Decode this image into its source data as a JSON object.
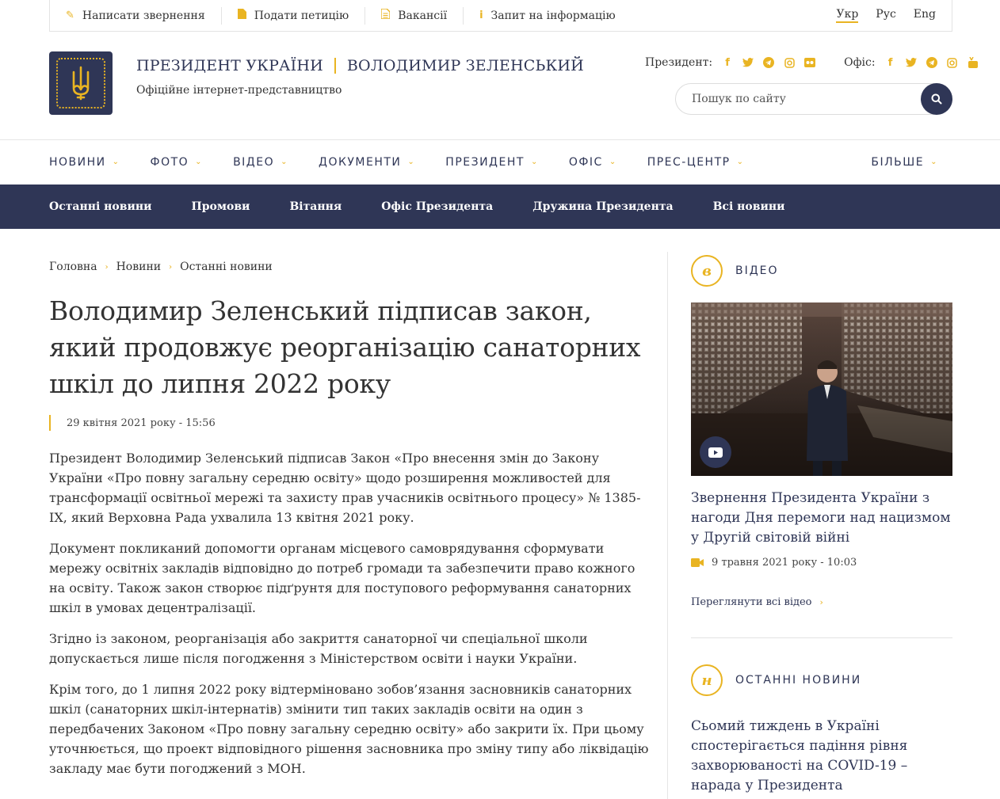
{
  "utility": {
    "links": [
      {
        "label": "Написати звернення",
        "icon": "pencil-icon"
      },
      {
        "label": "Подати петицію",
        "icon": "document-icon"
      },
      {
        "label": "Вакансії",
        "icon": "list-icon"
      },
      {
        "label": "Запит на інформацію",
        "icon": "info-icon"
      }
    ],
    "languages": [
      "Укр",
      "Рус",
      "Eng"
    ],
    "active_language": "Укр"
  },
  "header": {
    "title_left": "ПРЕЗИДЕНТ УКРАЇНИ",
    "title_right": "ВОЛОДИМИР ЗЕЛЕНСЬКИЙ",
    "subtitle": "Офіційне інтернет-представництво",
    "president_label": "Президент:",
    "office_label": "Офіс:",
    "president_socials": [
      "facebook-icon",
      "twitter-icon",
      "telegram-icon",
      "instagram-icon",
      "flickr-icon"
    ],
    "office_socials": [
      "facebook-icon",
      "twitter-icon",
      "telegram-icon",
      "instagram-icon",
      "youtube-icon"
    ],
    "search_placeholder": "Пошук по сайту"
  },
  "main_nav": {
    "items": [
      "НОВИНИ",
      "ФОТО",
      "ВІДЕО",
      "ДОКУМЕНТИ",
      "ПРЕЗИДЕНТ",
      "ОФІС",
      "ПРЕС-ЦЕНТР"
    ],
    "more": "БІЛЬШЕ"
  },
  "sub_nav": {
    "items": [
      "Останні новини",
      "Промови",
      "Вітання",
      "Офіс Президента",
      "Дружина Президента",
      "Всі новини"
    ]
  },
  "breadcrumb": [
    "Головна",
    "Новини",
    "Останні новини"
  ],
  "article": {
    "title": "Володимир Зеленський підписав закон, який продовжує реорганізацію санаторних шкіл до липня 2022 року",
    "date": "29 квітня 2021 року - 15:56",
    "paragraphs": [
      "Президент Володимир Зеленський підписав Закон «Про внесення змін до Закону України «Про повну загальну середню освіту» щодо розширення можливостей для трансформації освітньої мережі та захисту прав учасників освітнього процесу» № 1385-IX, який Верховна Рада ухвалила 13 квітня 2021 року.",
      "Документ покликаний допомогти органам місцевого самоврядування сформувати мережу освітніх закладів відповідно до потреб громади та забезпечити право кожного на освіту. Також закон створює підґрунтя для поступового реформування санаторних шкіл в умовах децентралізації.",
      "Згідно із законом, реорганізація або закриття санаторної чи спеціальної школи допускається лише після погодження з Міністерством освіти і науки України.",
      "Крім того, до 1 липня 2022 року відтерміновано зобов’язання засновників санаторних шкіл (санаторних шкіл-інтернатів) змінити тип таких закладів освіти на один з передбачених Законом «Про повну загальну середню освіту» або закрити їх. При цьому уточнюється, що проект відповідного рішення засновника про зміну типу або ліквідацію закладу має бути погоджений з МОН."
    ]
  },
  "sidebar": {
    "video": {
      "badge": "в",
      "heading": "ВІДЕО",
      "title": "Звернення Президента України з нагоди Дня перемоги над нацизмом у Другій світовій війні",
      "date": "9 травня 2021 року - 10:03",
      "view_all": "Переглянути всі відео"
    },
    "news": {
      "badge": "н",
      "heading": "ОСТАННІ НОВИНИ",
      "title": "Сьомий тиждень в Україні спостерігається падіння рівня захворюваності на COVID-19 – нарада у Президента"
    }
  },
  "colors": {
    "navy": "#2f3656",
    "gold": "#e9b422"
  }
}
